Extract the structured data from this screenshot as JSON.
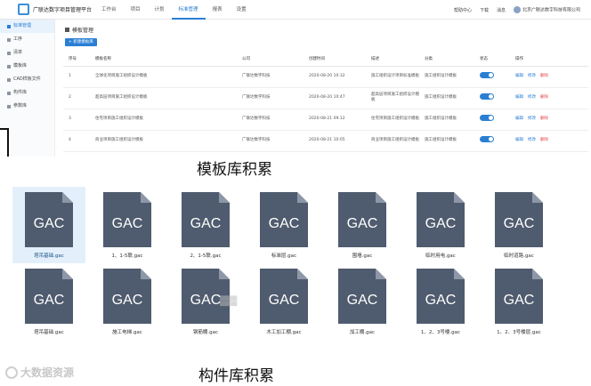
{
  "app": {
    "title": "广联达数字项目管理平台",
    "nav": [
      "工作台",
      "项目",
      "计划",
      "标准管理",
      "报表",
      "设置"
    ],
    "nav_active_index": 3,
    "topright": [
      "帮助中心",
      "下载",
      "消息",
      "北京广联达数字科技有限公司"
    ],
    "sidebar": [
      "标准管理",
      "工序",
      "清单",
      "模板库",
      "CAD样板文件",
      "构件库",
      "参数库"
    ],
    "sidebar_active_index": 0,
    "section_title": "模板管理",
    "add_button": "+ 新建模板库",
    "table": {
      "columns": [
        "序号",
        "模板名称",
        "公司",
        "创建时间",
        "描述",
        "分类",
        "状态",
        "操作"
      ],
      "rows": [
        [
          "1",
          "全球化项目施工组织设计模板",
          "广联达数字科技",
          "2020-08-20 10:32",
          "施工组织设计项目标准模板",
          "施工组织设计模板",
          "on",
          "编辑|修改|删除"
        ],
        [
          "2",
          "超高层项目施工组织设计模板",
          "广联达数字科技",
          "2020-08-20 10:47",
          "超高层项目施工组织设计模板",
          "施工组织设计模板",
          "on",
          "编辑|修改|删除"
        ],
        [
          "3",
          "住宅项目施工组织设计模板",
          "广联达数字科技",
          "2020-08-21 09:12",
          "住宅项目施工组织设计模板",
          "施工组织设计模板",
          "on",
          "编辑|修改|删除"
        ],
        [
          "4",
          "商业项目施工组织设计模板",
          "广联达数字科技",
          "2020-08-21 10:05",
          "商业项目施工组织设计模板",
          "施工组织设计模板",
          "on",
          "编辑|修改|删除"
        ]
      ]
    }
  },
  "captions": {
    "template": "模板库积累",
    "component": "构件库积累"
  },
  "files": {
    "icon_label": "GAC",
    "row1": [
      "塔吊基础.gac",
      "1、1-5联.gac",
      "2、1-5联.gac",
      "标准层.gac",
      "围墙.gac",
      "临时用电.gac",
      "临时道路.gac"
    ],
    "row2": [
      "塔吊基础.gac",
      "施工电梯.gac",
      "钢筋棚.gac",
      "木工加工棚.gac",
      "加工棚.gac",
      "1、2、3号楼.gac",
      "1、2、3号楼层.gac"
    ],
    "selected": "row1.0"
  },
  "watermark": "大数据资源",
  "colors": {
    "accent": "#2a7fd4",
    "doc_body": "#4f5b6e",
    "selection": "#e3f0fc",
    "danger": "#e0474c"
  }
}
